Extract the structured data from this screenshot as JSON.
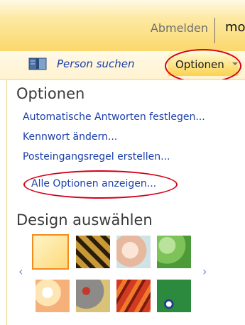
{
  "header": {
    "signout_label": "Abmelden",
    "user_name": "mo"
  },
  "toolbar": {
    "find_person_label": "Person suchen",
    "options_button_label": "Optionen"
  },
  "menu": {
    "section_title": "Optionen",
    "items": [
      {
        "label": "Automatische Antworten festlegen..."
      },
      {
        "label": "Kennwort ändern..."
      },
      {
        "label": "Posteingangsregel erstellen..."
      },
      {
        "label": "Alle Optionen anzeigen..."
      }
    ]
  },
  "design": {
    "section_title": "Design auswählen",
    "prev_arrow": "‹",
    "next_arrow": "›",
    "selected_index": 0,
    "themes": [
      {
        "icon": "plain-yellow-theme",
        "color": "#fdd97a"
      },
      {
        "icon": "tiger-theme",
        "color": "#c99a33"
      },
      {
        "icon": "shells-theme",
        "color": "#e7b79e"
      },
      {
        "icon": "leaves-theme",
        "color": "#7ec35a"
      },
      {
        "icon": "sunset-bubbles-theme",
        "color": "#f6b07a"
      },
      {
        "icon": "robot-theme",
        "color": "#8d8a8a"
      },
      {
        "icon": "autumn-leaves-theme",
        "color": "#d33a22"
      },
      {
        "icon": "cartoon-creature-theme",
        "color": "#2c8a3e"
      }
    ]
  },
  "colors": {
    "link": "#1a3fa8",
    "highlight_ellipse": "#d4001a",
    "accent": "#fbd24f"
  }
}
